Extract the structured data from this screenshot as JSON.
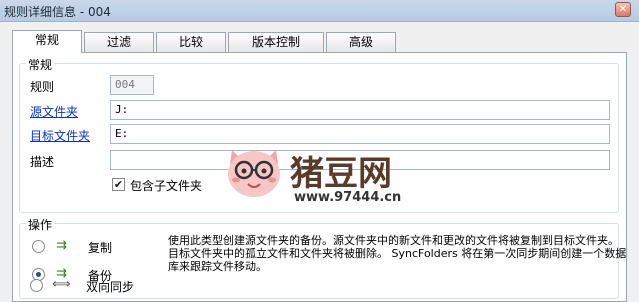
{
  "window": {
    "title": "规则详细信息 - 004",
    "close_glyph": "✕"
  },
  "tabs": [
    {
      "label": "常规",
      "active": true
    },
    {
      "label": "过滤"
    },
    {
      "label": "比较"
    },
    {
      "label": "版本控制"
    },
    {
      "label": "高级"
    }
  ],
  "general": {
    "group_label": "常规",
    "rule_label": "规则",
    "rule_value": "004",
    "source_label": "源文件夹",
    "source_value": "J:",
    "target_label": "目标文件夹",
    "target_value": "E:",
    "desc_label": "描述",
    "desc_value": "",
    "include_sub_label": "包含子文件夹",
    "include_sub_checked": true
  },
  "operation": {
    "group_label": "操作",
    "options": [
      {
        "label": "复制",
        "icon": "copy-arrow-icon",
        "selected": false
      },
      {
        "label": "备份",
        "icon": "backup-arrow-icon",
        "selected": true
      },
      {
        "label": "双向同步",
        "icon": "sync-arrows-icon",
        "selected": false
      }
    ],
    "description": "使用此类型创建源文件夹的备份。源文件夹中的新文件和更改的文件将被复制到目标文件夹。目标文件夹中的孤立文件和文件夹将被删除。 SyncFolders 将在第一次同步期间创建一个数据库来跟踪文件移动。"
  },
  "watermark": {
    "text": "猪豆网",
    "url": "www.97444.cn"
  },
  "colors": {
    "link": "#0a33c4",
    "accent": "#2c4f86",
    "logo_brown": "#5a3b2a"
  }
}
